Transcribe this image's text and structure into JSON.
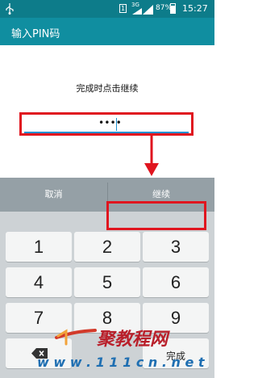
{
  "status_bar": {
    "sim_label": "1",
    "network_type": "3G",
    "battery_percent": "87%",
    "time": "15:27",
    "icons": [
      "usb-icon",
      "sim-icon",
      "signal-icon",
      "battery-icon"
    ]
  },
  "header": {
    "title": "输入PIN码"
  },
  "instruction": "完成时点击继续",
  "pin_field": {
    "masked_value": "••••"
  },
  "keyboard": {
    "cancel_label": "取消",
    "continue_label": "继续",
    "keys": [
      "1",
      "2",
      "3",
      "4",
      "5",
      "6",
      "7",
      "8",
      "9"
    ],
    "done_label": "完成",
    "backspace_icon": "backspace-icon"
  },
  "watermark": {
    "brand": "一聚教程网",
    "url": "www.111cn.net"
  },
  "colors": {
    "status_bar": "#0d7c8a",
    "app_bar": "#108ea0",
    "accent": "#1a8fd0",
    "highlight": "#e0151f",
    "keyboard_bg": "#cdd2d5",
    "action_row_bg": "#95a0a6",
    "key_bg": "#f4f5f5"
  }
}
